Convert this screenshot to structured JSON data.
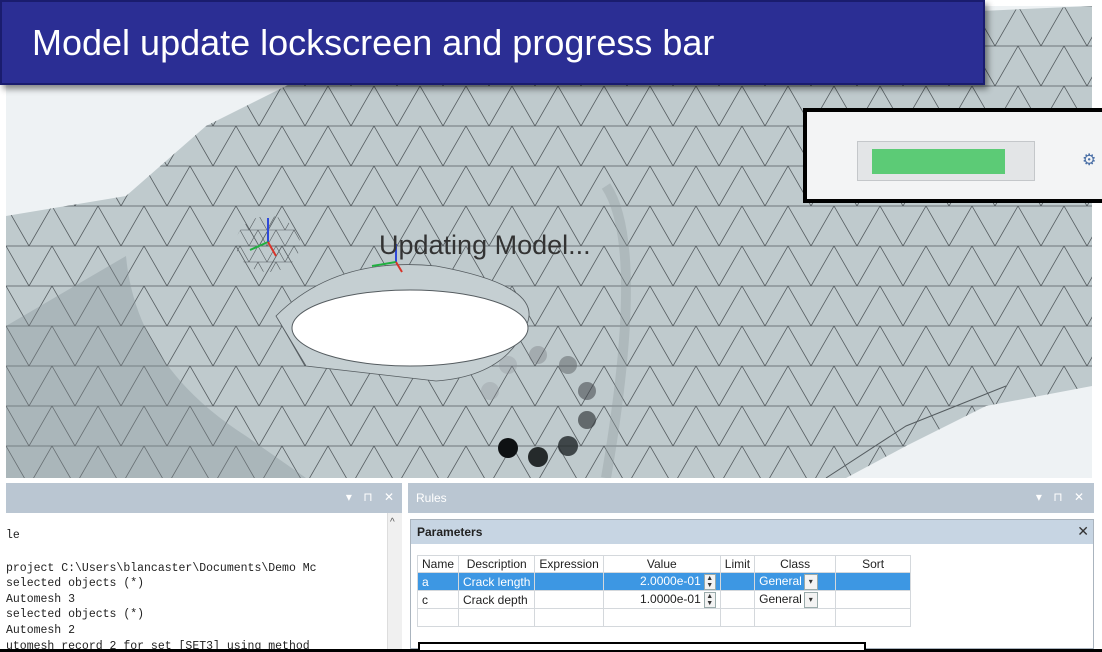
{
  "title_banner": {
    "text": "Model update lockscreen and progress bar"
  },
  "viewport": {
    "status_text": "Updating Model...",
    "mesh_color": "#bfcacd",
    "spinner_icon": "loading-spinner-icon",
    "axis_triad_icon": "axis-triad-icon"
  },
  "inset": {
    "progress_fraction": 0.9,
    "progress_color": "#5ccb76",
    "icon": "gear-icon",
    "icon_glyph": "⚙"
  },
  "log_panel": {
    "header_controls": "▾ ⊓ ✕",
    "scroll_up": "^",
    "lines": [
      "le",
      "",
      "project C:\\Users\\blancaster\\Documents\\Demo Mc",
      "selected objects (*)",
      "Automesh 3",
      "selected objects (*)",
      "Automesh 2",
      "utomesh record 2 for set [SET3] using method"
    ]
  },
  "rules_panel": {
    "title": "Rules",
    "header_controls": "▾ ⊓ ✕",
    "params_title": "Parameters",
    "close": "✕",
    "columns": [
      "Name",
      "Description",
      "Expression",
      "Value",
      "Limit",
      "Class",
      "Sort"
    ],
    "rows": [
      {
        "name": "a",
        "description": "Crack length",
        "expression": "",
        "value": "2.0000e-01",
        "limit": "",
        "class": "General",
        "sort": ""
      },
      {
        "name": "c",
        "description": "Crack depth",
        "expression": "",
        "value": "1.0000e-01",
        "limit": "",
        "class": "General",
        "sort": ""
      }
    ]
  }
}
